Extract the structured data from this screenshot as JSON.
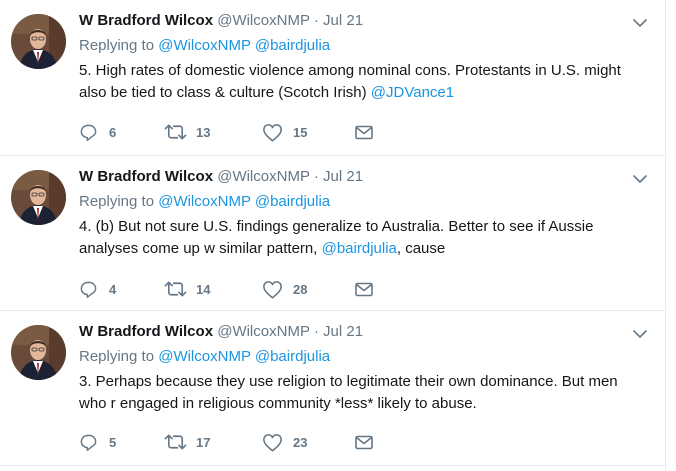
{
  "tweets": [
    {
      "author": "W Bradford Wilcox",
      "handle": "@WilcoxNMP",
      "separator": "·",
      "date": "Jul 21",
      "reply_prefix": "Replying to",
      "reply_to": [
        "@WilcoxNMP",
        "@bairdjulia"
      ],
      "text_parts": [
        {
          "text": "5. High rates of domestic violence among nominal cons. Protestants in U.S. might also be tied to class & culture (Scotch Irish) ",
          "type": "plain"
        },
        {
          "text": "@JDVance1",
          "type": "mention"
        }
      ],
      "replies": "6",
      "retweets": "13",
      "likes": "15"
    },
    {
      "author": "W Bradford Wilcox",
      "handle": "@WilcoxNMP",
      "separator": "·",
      "date": "Jul 21",
      "reply_prefix": "Replying to",
      "reply_to": [
        "@WilcoxNMP",
        "@bairdjulia"
      ],
      "text_parts": [
        {
          "text": "4. (b) But not sure U.S. findings generalize to Australia. Better to see if Aussie analyses come up w similar pattern, ",
          "type": "plain"
        },
        {
          "text": "@bairdjulia",
          "type": "mention"
        },
        {
          "text": ", cause",
          "type": "plain"
        }
      ],
      "replies": "4",
      "retweets": "14",
      "likes": "28"
    },
    {
      "author": "W Bradford Wilcox",
      "handle": "@WilcoxNMP",
      "separator": "·",
      "date": "Jul 21",
      "reply_prefix": "Replying to",
      "reply_to": [
        "@WilcoxNMP",
        "@bairdjulia"
      ],
      "text_parts": [
        {
          "text": "3. Perhaps because they use religion to legitimate their own dominance. But men who r engaged in religious community *less* likely to abuse.",
          "type": "plain"
        }
      ],
      "replies": "5",
      "retweets": "17",
      "likes": "23"
    }
  ],
  "icons": {
    "reply": "reply-icon",
    "retweet": "retweet-icon",
    "like": "heart-icon",
    "dm": "envelope-icon",
    "more": "chevron-down-icon"
  },
  "colors": {
    "link": "#1b95e0",
    "muted": "#657786",
    "text": "#14171a",
    "border": "#e6ecf0"
  }
}
